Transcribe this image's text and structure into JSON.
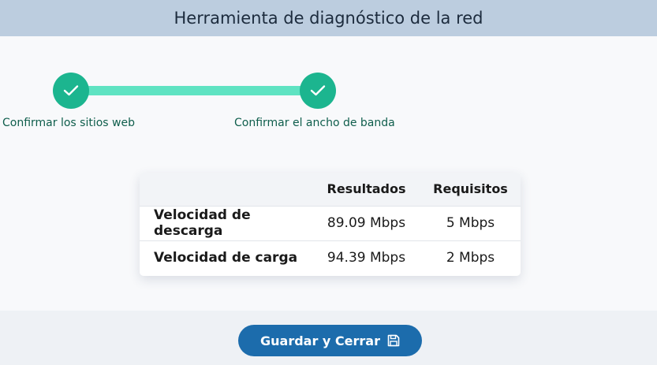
{
  "header": {
    "title": "Herramienta de diagnóstico de la red"
  },
  "steps": [
    {
      "label": "Confirmar los sitios web",
      "status": "complete",
      "icon": "check-icon"
    },
    {
      "label": "Confirmar el ancho de banda",
      "status": "complete",
      "icon": "check-icon"
    }
  ],
  "results_table": {
    "columns": [
      "",
      "Resultados",
      "Requisitos"
    ],
    "rows": [
      {
        "name": "Velocidad de descarga",
        "result": "89.09 Mbps",
        "requirement": "5 Mbps"
      },
      {
        "name": "Velocidad de carga",
        "result": "94.39 Mbps",
        "requirement": "2 Mbps"
      }
    ]
  },
  "footer": {
    "save_label": "Guardar y Cerrar",
    "save_icon": "floppy-disk-icon"
  },
  "colors": {
    "header_bg": "#bccddf",
    "step_complete": "#1cb58f",
    "step_line": "#5fe3c2",
    "step_label": "#0f5e4c",
    "button_bg": "#1c6cac"
  }
}
